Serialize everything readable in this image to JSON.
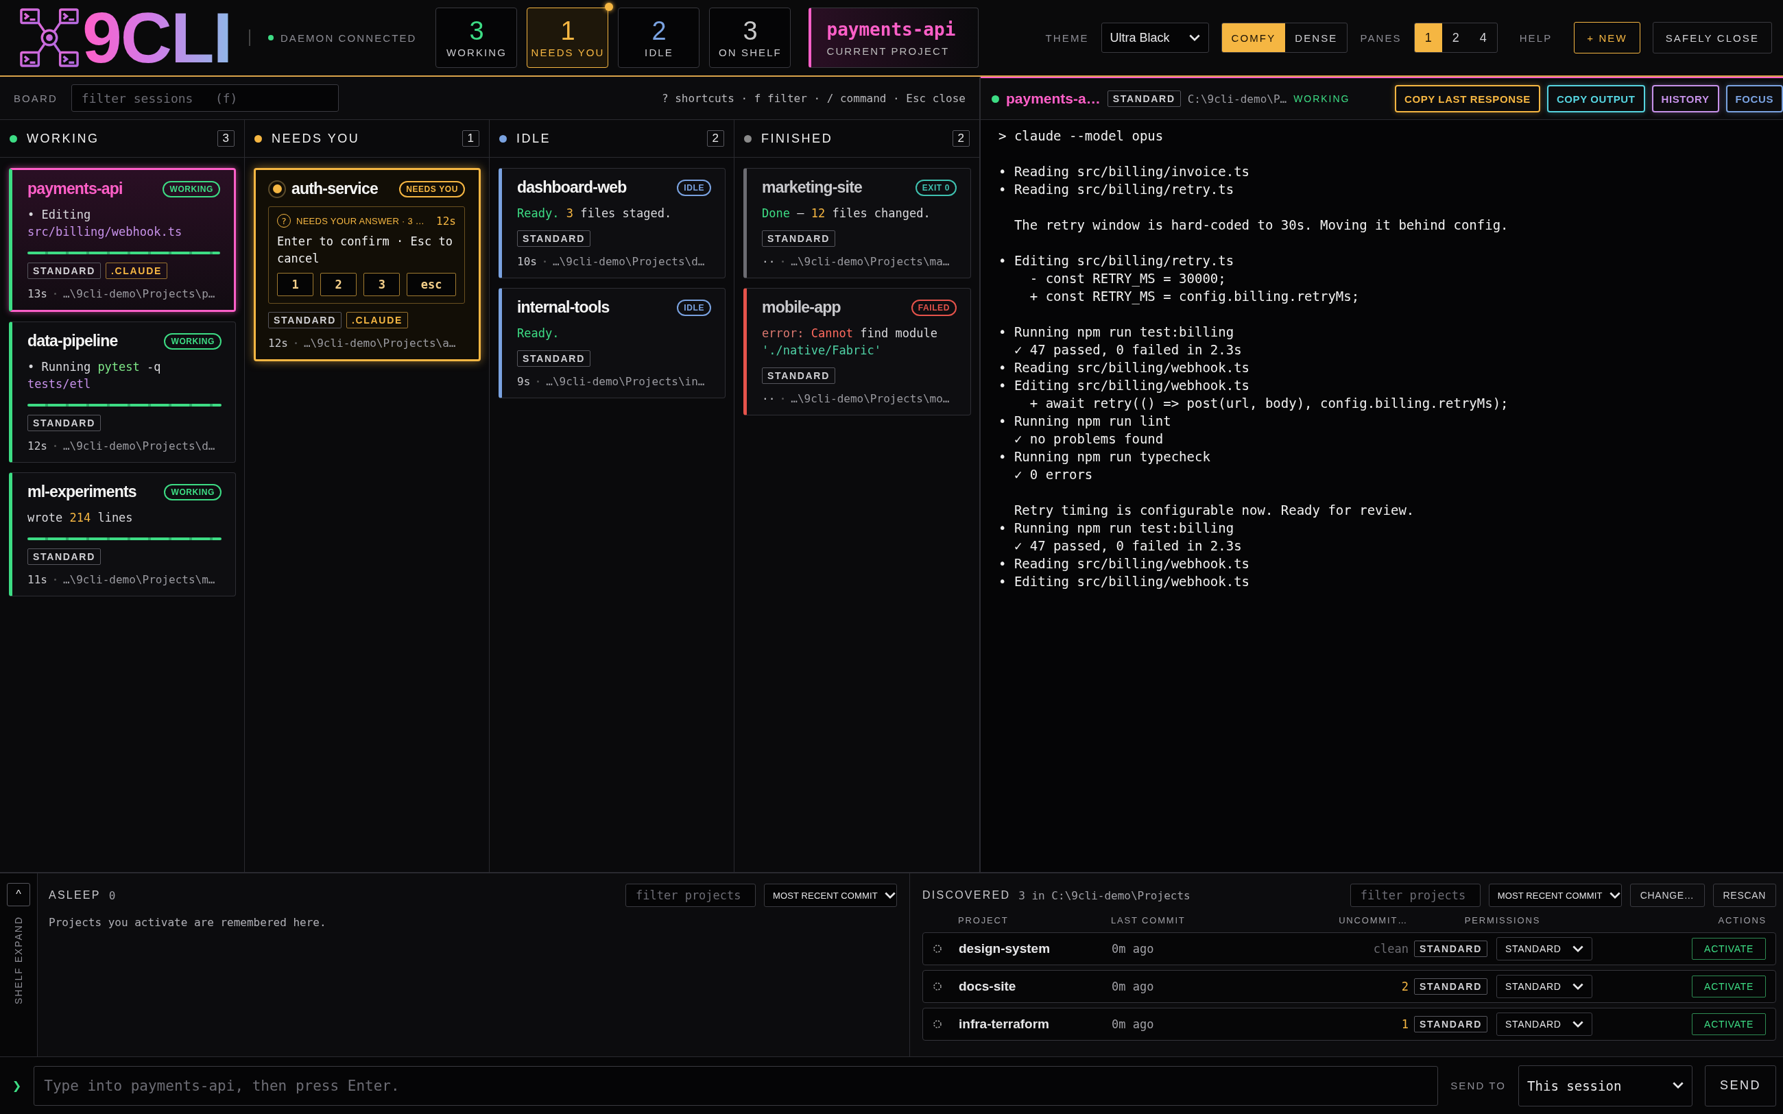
{
  "header": {
    "logo": "9CLI",
    "daemon": {
      "label": "DAEMON CONNECTED",
      "connected": true
    },
    "stats": [
      {
        "value": "3",
        "label": "WORKING",
        "color": "#3ddc84",
        "selected": false,
        "alert": false
      },
      {
        "value": "1",
        "label": "NEEDS YOU",
        "color": "#f5b642",
        "selected": true,
        "alert": true
      },
      {
        "value": "2",
        "label": "IDLE",
        "color": "#7aa2e0",
        "selected": false,
        "alert": false
      },
      {
        "value": "3",
        "label": "ON SHELF",
        "color": "#c8c8c8",
        "selected": false,
        "alert": false
      }
    ],
    "current_project": {
      "name": "payments-api",
      "label": "CURRENT PROJECT"
    },
    "theme": {
      "label": "THEME",
      "value": "Ultra Black"
    },
    "density": [
      {
        "label": "COMFY",
        "selected": true
      },
      {
        "label": "DENSE",
        "selected": false
      }
    ],
    "panes": {
      "label": "PANES",
      "options": [
        {
          "label": "1",
          "selected": true
        },
        {
          "label": "2",
          "selected": false
        },
        {
          "label": "4",
          "selected": false
        }
      ]
    },
    "help": "HELP",
    "new_button": "+ NEW",
    "close_button": "SAFELY CLOSE"
  },
  "board": {
    "label": "BOARD",
    "filter_placeholder": "filter sessions   (f)",
    "hints": "? shortcuts · f filter · / command · Esc close",
    "columns": [
      {
        "title": "WORKING",
        "count": "3",
        "color": "#3ddc84",
        "cards": [
          {
            "name": "payments-api",
            "kind": "working",
            "selected": true,
            "badge": {
              "label": "WORKING",
              "kind": "working"
            },
            "body": [
              {
                "text": "• Editing",
                "kind": "plain"
              },
              {
                "text": "src/billing/webhook.ts",
                "kind": "path"
              }
            ],
            "busy": true,
            "tags": [
              {
                "label": "STANDARD",
                "kind": "perm"
              },
              {
                "label": ".CLAUDE",
                "kind": "config"
              }
            ],
            "age": "13s",
            "path": "…\\9cli-demo\\Projects\\p…"
          },
          {
            "name": "data-pipeline",
            "kind": "working",
            "selected": false,
            "badge": {
              "label": "WORKING",
              "kind": "working"
            },
            "body": [
              {
                "text": "• Running",
                "kind": "plain"
              },
              {
                "text": "pytest",
                "kind": "cmd"
              },
              {
                "text": "-q",
                "kind": "plain"
              },
              {
                "text": "tests/etl",
                "kind": "path"
              }
            ],
            "busy": true,
            "tags": [
              {
                "label": "STANDARD",
                "kind": "perm"
              }
            ],
            "age": "12s",
            "path": "…\\9cli-demo\\Projects\\d…"
          },
          {
            "name": "ml-experiments",
            "kind": "working",
            "selected": false,
            "badge": {
              "label": "WORKING",
              "kind": "working"
            },
            "body": [
              {
                "text": "wrote",
                "kind": "plain"
              },
              {
                "text": "214",
                "kind": "num"
              },
              {
                "text": "lines",
                "kind": "plain"
              }
            ],
            "busy": true,
            "tags": [
              {
                "label": "STANDARD",
                "kind": "perm"
              }
            ],
            "age": "11s",
            "path": "…\\9cli-demo\\Projects\\m…"
          }
        ]
      },
      {
        "title": "NEEDS YOU",
        "count": "1",
        "color": "#f5b642",
        "cards": [
          {
            "name": "auth-service",
            "kind": "needs",
            "selected": false,
            "badge": {
              "label": "NEEDS YOU",
              "kind": "needs"
            },
            "prompt": {
              "icon": "?",
              "title": "NEEDS YOUR ANSWER · 3 …",
              "time": "12s",
              "text": "Enter to confirm · Esc to cancel",
              "options": [
                "1",
                "2",
                "3",
                "esc"
              ]
            },
            "busy": false,
            "tags": [
              {
                "label": "STANDARD",
                "kind": "perm"
              },
              {
                "label": ".CLAUDE",
                "kind": "config"
              }
            ],
            "age": "12s",
            "path": "…\\9cli-demo\\Projects\\a…"
          }
        ]
      },
      {
        "title": "IDLE",
        "count": "2",
        "color": "#7aa2e0",
        "cards": [
          {
            "name": "dashboard-web",
            "kind": "idle",
            "selected": false,
            "badge": {
              "label": "IDLE",
              "kind": "idle"
            },
            "body": [
              {
                "text": "Ready.",
                "kind": "ok"
              },
              {
                "text": "3",
                "kind": "num"
              },
              {
                "text": "files staged.",
                "kind": "plain"
              }
            ],
            "busy": false,
            "tags": [
              {
                "label": "STANDARD",
                "kind": "perm"
              }
            ],
            "age": "10s",
            "path": "…\\9cli-demo\\Projects\\d…"
          },
          {
            "name": "internal-tools",
            "kind": "idle",
            "selected": false,
            "badge": {
              "label": "IDLE",
              "kind": "idle"
            },
            "body": [
              {
                "text": "Ready.",
                "kind": "ok"
              }
            ],
            "busy": false,
            "tags": [
              {
                "label": "STANDARD",
                "kind": "perm"
              }
            ],
            "age": "9s",
            "path": "…\\9cli-demo\\Projects\\in…"
          }
        ]
      },
      {
        "title": "FINISHED",
        "count": "2",
        "color": "#8a8a8a",
        "cards": [
          {
            "name": "marketing-site",
            "kind": "done",
            "selected": false,
            "badge": {
              "label": "EXIT 0",
              "kind": "exit"
            },
            "body": [
              {
                "text": "Done",
                "kind": "ok"
              },
              {
                "text": "—",
                "kind": "plain"
              },
              {
                "text": "12",
                "kind": "num"
              },
              {
                "text": "files changed.",
                "kind": "plain"
              }
            ],
            "busy": false,
            "tags": [
              {
                "label": "STANDARD",
                "kind": "perm"
              }
            ],
            "age": "··",
            "path": "…\\9cli-demo\\Projects\\ma…"
          },
          {
            "name": "mobile-app",
            "kind": "failed",
            "selected": false,
            "badge": {
              "label": "FAILED",
              "kind": "failed"
            },
            "body": [
              {
                "text": "error:",
                "kind": "errlabel"
              },
              {
                "text": "Cannot",
                "kind": "err"
              },
              {
                "text": "find module",
                "kind": "plain"
              },
              {
                "text": "'./native/Fabric'",
                "kind": "string"
              }
            ],
            "busy": false,
            "tags": [
              {
                "label": "STANDARD",
                "kind": "perm"
              }
            ],
            "age": "··",
            "path": "…\\9cli-demo\\Projects\\mo…"
          }
        ]
      }
    ]
  },
  "terminal": {
    "name": "payments-a…",
    "tag": "STANDARD",
    "path": "C:\\9cli-demo\\P…",
    "state": "WORKING",
    "buttons": [
      {
        "label": "COPY LAST RESPONSE",
        "color": "#f5b642"
      },
      {
        "label": "COPY OUTPUT",
        "color": "#56d4e0"
      },
      {
        "label": "HISTORY",
        "color": "#c792ea"
      },
      {
        "label": "FOCUS",
        "color": "#7aa2e0"
      }
    ],
    "lines": [
      {
        "kind": "cmd",
        "text": "> claude --model opus"
      },
      {
        "kind": "gap"
      },
      {
        "kind": "item",
        "text": "• Reading src/billing/invoice.ts"
      },
      {
        "kind": "item",
        "text": "• Reading src/billing/retry.ts"
      },
      {
        "kind": "gap"
      },
      {
        "kind": "text",
        "text": "The retry window is hard-coded to 30s. Moving it behind config."
      },
      {
        "kind": "gap"
      },
      {
        "kind": "item",
        "text": "• Editing src/billing/retry.ts"
      },
      {
        "kind": "code",
        "text": "- const RETRY_MS = 30000;"
      },
      {
        "kind": "code",
        "text": "+ const RETRY_MS = config.billing.retryMs;"
      },
      {
        "kind": "gap"
      },
      {
        "kind": "item",
        "text": "• Running npm run test:billing"
      },
      {
        "kind": "text",
        "text": "✓ 47 passed, 0 failed in 2.3s"
      },
      {
        "kind": "item",
        "text": "• Reading src/billing/webhook.ts"
      },
      {
        "kind": "item",
        "text": "• Editing src/billing/webhook.ts"
      },
      {
        "kind": "code",
        "text": "+ await retry(() => post(url, body), config.billing.retryMs);"
      },
      {
        "kind": "item",
        "text": "• Running npm run lint"
      },
      {
        "kind": "text",
        "text": "✓ no problems found"
      },
      {
        "kind": "item",
        "text": "• Running npm run typecheck"
      },
      {
        "kind": "text",
        "text": "✓ 0 errors"
      },
      {
        "kind": "gap"
      },
      {
        "kind": "text",
        "text": "Retry timing is configurable now. Ready for review."
      },
      {
        "kind": "item",
        "text": "• Running npm run test:billing"
      },
      {
        "kind": "text",
        "text": "✓ 47 passed, 0 failed in 2.3s"
      },
      {
        "kind": "item",
        "text": "• Reading src/billing/webhook.ts"
      },
      {
        "kind": "item",
        "text": "• Editing src/billing/webhook.ts"
      }
    ]
  },
  "shelf": {
    "expand_button": "^",
    "rail_label": "SHELF EXPAND",
    "asleep": {
      "title": "ASLEEP",
      "count": "0",
      "filter_placeholder": "filter projects",
      "sort": "MOST RECENT COMMIT",
      "empty_text": "Projects you activate are remembered here."
    },
    "discovered": {
      "title": "DISCOVERED",
      "summary": "3 in C:\\9cli-demo\\Projects",
      "filter_placeholder": "filter projects",
      "sort": "MOST RECENT COMMIT",
      "change_button": "CHANGE…",
      "rescan_button": "RESCAN",
      "columns": [
        "PROJECT",
        "LAST COMMIT",
        "UNCOMMIT…",
        "PERMISSIONS",
        "ACTIONS"
      ],
      "rows": [
        {
          "name": "design-system",
          "last_commit": "0m ago",
          "uncommitted": "clean",
          "kind": "clean",
          "tag": "STANDARD",
          "permission": "STANDARD",
          "action": "ACTIVATE"
        },
        {
          "name": "docs-site",
          "last_commit": "0m ago",
          "uncommitted": "2",
          "kind": "dirty",
          "tag": "STANDARD",
          "permission": "STANDARD",
          "action": "ACTIVATE"
        },
        {
          "name": "infra-terraform",
          "last_commit": "0m ago",
          "uncommitted": "1",
          "kind": "dirty",
          "tag": "STANDARD",
          "permission": "STANDARD",
          "action": "ACTIVATE"
        }
      ]
    }
  },
  "composer": {
    "prompt": "❯",
    "placeholder": "Type into payments-api, then press Enter.",
    "send_to_label": "SEND TO",
    "target": "This session",
    "send_button": "SEND"
  }
}
